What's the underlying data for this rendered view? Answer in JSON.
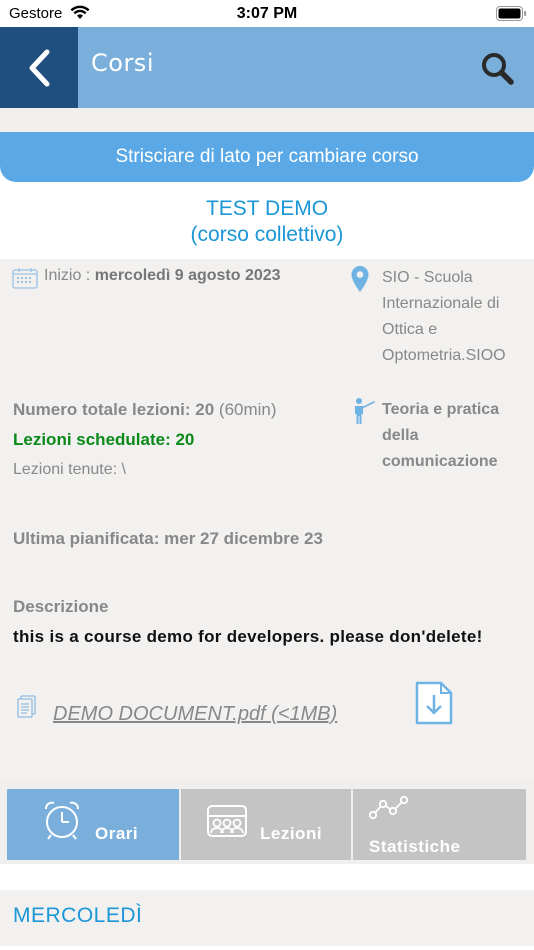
{
  "status_bar": {
    "carrier": "Gestore",
    "time": "3:07 PM"
  },
  "nav": {
    "title": "Corsi"
  },
  "banner": {
    "text": "Strisciare di lato per cambiare corso"
  },
  "course": {
    "name": "TEST DEMO",
    "type": "(corso collettivo)",
    "start_label": "Inizio : ",
    "start_value": "mercoledì 9 agosto 2023",
    "location": "SIO - Scuola Internazionale di Ottica e Optometria.SIOO",
    "lessons_total_label": "Numero totale lezioni: 20",
    "lessons_total_duration": " (60min)",
    "lessons_scheduled": "Lezioni schedulate: 20",
    "lessons_held": "Lezioni tenute: \\",
    "subject": "Teoria e pratica della comunicazione",
    "last_planned": "Ultima pianificata: mer 27 dicembre 23",
    "description_label": "Descrizione",
    "description_text": "this is a course demo for developers. please don'delete!",
    "document_link": "DEMO DOCUMENT.pdf (<1MB) "
  },
  "tabs": [
    {
      "label": "Orari",
      "icon": "alarm-clock-icon",
      "active": true
    },
    {
      "label": "Lezioni",
      "icon": "classroom-icon",
      "active": false
    },
    {
      "label": "Statistiche",
      "icon": "stats-line-icon",
      "active": false
    }
  ],
  "schedule": {
    "day_header": "MERCOLEDÌ"
  },
  "colors": {
    "nav_bg": "#7aaedb",
    "back_bg": "#1f4f7f",
    "banner_bg": "#5aa9e6",
    "accent_blue": "#1b96d6",
    "scheduled_green": "#0b8a1a",
    "tab_inactive": "#c4c4c4"
  }
}
